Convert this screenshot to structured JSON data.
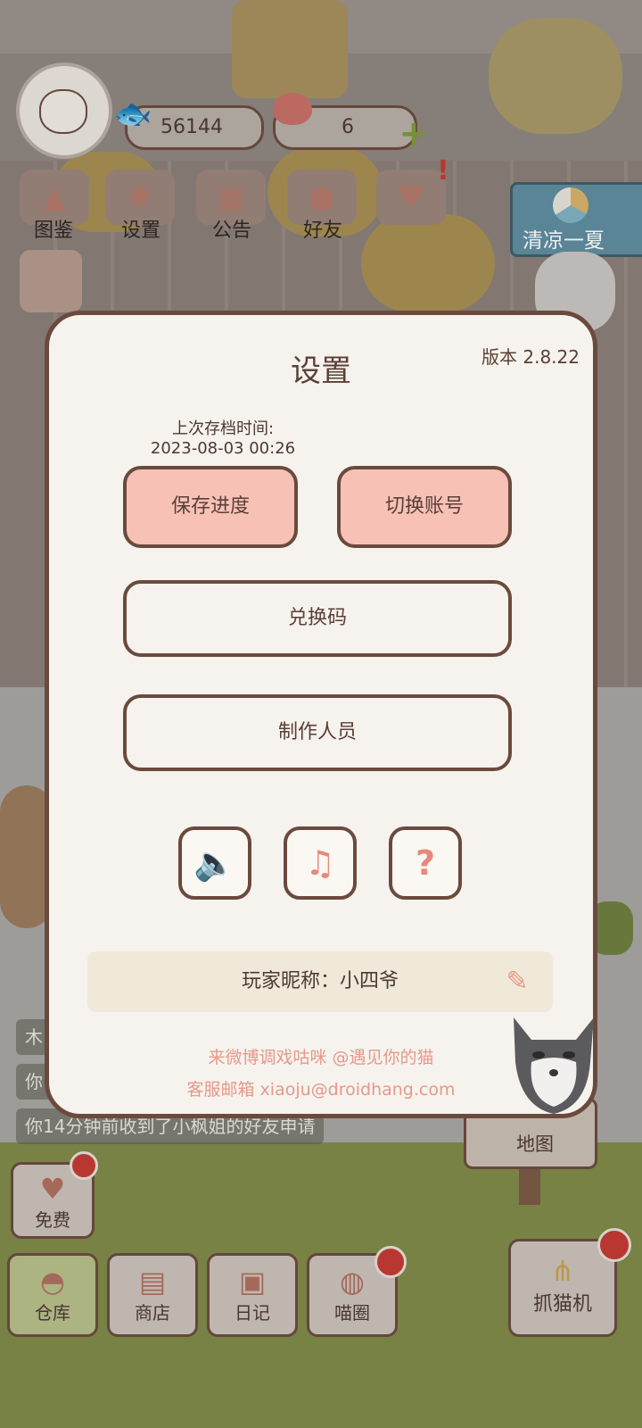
{
  "hud": {
    "coins": "56144",
    "hearts": "6",
    "nav": [
      {
        "label": "图鉴",
        "icon": "cat-book-icon"
      },
      {
        "label": "设置",
        "icon": "gear-icon"
      },
      {
        "label": "公告",
        "icon": "gift-icon"
      },
      {
        "label": "好友",
        "icon": "friends-icon"
      }
    ],
    "event_banner": "清凉一夏"
  },
  "chat": [
    {
      "text": "木"
    },
    {
      "text": "你1"
    },
    {
      "text": "你14分钟前收到了小枫姐的好友申请"
    }
  ],
  "map_label": "地图",
  "free_label": "免费",
  "bottom_nav": [
    {
      "label": "仓库",
      "icon": "warehouse-icon"
    },
    {
      "label": "商店",
      "icon": "shop-icon"
    },
    {
      "label": "日记",
      "icon": "diary-icon"
    },
    {
      "label": "喵圈",
      "icon": "planet-cat-icon"
    }
  ],
  "claw_label": "抓猫机",
  "dialog": {
    "title": "设置",
    "version": "版本 2.8.22",
    "last_save_label": "上次存档时间:",
    "last_save_time": "2023-08-03 00:26",
    "save_button": "保存进度",
    "switch_button": "切换账号",
    "redeem_button": "兑换码",
    "credits_button": "制作人员",
    "sound_icon": "speaker-icon",
    "music_icon": "music-note-icon",
    "help_icon": "question-icon",
    "nickname_label": "玩家昵称：小四爷",
    "weibo_line": "来微博调戏咕咪 @遇见你的猫",
    "email_line": "客服邮箱 xiaoju@droidhang.com"
  },
  "colors": {
    "dialog_bg": "#f6f3ee",
    "border": "#6b4a3e",
    "pink_button": "#f7c1b6",
    "accent_text": "#e5998a"
  }
}
